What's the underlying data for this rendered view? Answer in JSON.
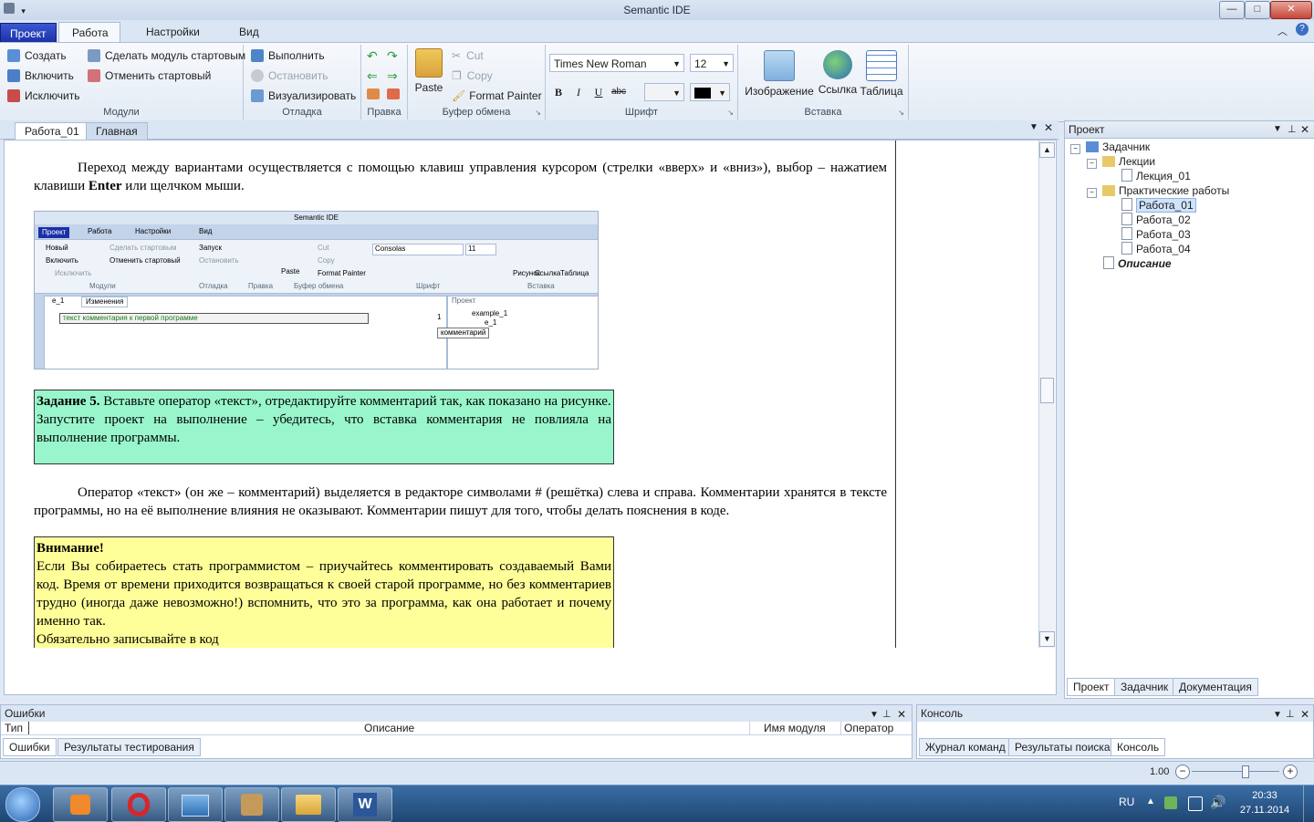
{
  "window": {
    "title": "Semantic IDE",
    "buttons": {
      "minimize": "—",
      "maximize": "□",
      "close": "✕"
    }
  },
  "ribbon_tabs": [
    "Проект",
    "Работа",
    "Настройки",
    "Вид"
  ],
  "ribbon": {
    "modules": {
      "label": "Модули",
      "create": "Создать",
      "include": "Включить",
      "exclude": "Исключить",
      "make_start": "Сделать модуль стартовым",
      "cancel_start": "Отменить стартовый"
    },
    "debug": {
      "label": "Отладка",
      "run": "Выполнить",
      "stop": "Остановить",
      "visualize": "Визуализировать"
    },
    "edit": {
      "label": "Правка"
    },
    "clipboard": {
      "label": "Буфер обмена",
      "paste": "Paste",
      "cut": "Cut",
      "copy": "Copy",
      "format_painter": "Format Painter"
    },
    "font": {
      "label": "Шрифт",
      "family": "Times New Roman",
      "size": "12",
      "bold": "B",
      "italic": "I",
      "underline": "U",
      "strike": "abc"
    },
    "insert": {
      "label": "Вставка",
      "image": "Изображение",
      "link": "Ссылка",
      "table": "Таблица"
    }
  },
  "doc_tabs": [
    "Работа_01",
    "Главная"
  ],
  "document": {
    "p1": "Переход между вариантами осуществляется с помощью клавиш управления курсором (стрелки «вверх» и «вниз»), выбор – нажатием клавиши",
    "p1_bold": "Enter",
    "p1_end": "или щелчком мыши.",
    "task_title": "Задание 5.",
    "task_text": "Вставьте оператор «текст», отредактируйте комментарий так, как показано на рисунке.",
    "task_text2": "Запустите проект на выполнение – убедитесь, что вставка комментария не повлияла на выполнение программы.",
    "p2": "Оператор «текст» (он же – комментарий) выделяется в редакторе символами # (решётка) слева и справа. Комментарии хранятся в тексте программы, но на её выполнение влияния не оказывают. Комментарии пишут для того, чтобы делать пояснения в коде.",
    "warn_title": "Внимание!",
    "warn_text": "Если Вы собираетесь стать программистом – приучайтесь комментировать создаваемый Вами код. Время от времени приходится возвращаться к своей старой программе, но без комментариев трудно (иногда даже невозможно!) вспомнить, что это за программа, как она работает и почему именно так.",
    "warn_text2": "Обязательно записывайте в код"
  },
  "embedded": {
    "title": "Semantic IDE",
    "tabs": [
      "Проект",
      "Работа",
      "Настройки",
      "Вид"
    ],
    "new": "Новый",
    "include": "Включить",
    "exclude": "Исключить",
    "make_start": "Сделать стартовым",
    "cancel_start": "Отменить стартовый",
    "run": "Запуск",
    "stop": "Остановить",
    "paste": "Paste",
    "cut": "Cut",
    "copy": "Copy",
    "format_painter": "Format Painter",
    "font": "Consolas",
    "size": "11",
    "image": "Рисунок",
    "link": "Ссылка",
    "table": "Таблица",
    "g_modules": "Модули",
    "g_debug": "Отладка",
    "g_edit": "Правка",
    "g_clip": "Буфер обмена",
    "g_font": "Шрифт",
    "g_insert": "Вставка",
    "doc_tab1": "e_1",
    "doc_tab2": "Изменения",
    "comment_line": "текст комментария к первой программе",
    "line_num": "1",
    "project_label": "Проект",
    "tree_root": "example_1",
    "tree_child": "e_1",
    "tooltip": "комментарий"
  },
  "project_panel": {
    "title": "Проект",
    "root": "Задачник",
    "lectures": "Лекции",
    "lecture_01": "Лекция_01",
    "practicals": "Практические работы",
    "works": [
      "Работа_01",
      "Работа_02",
      "Работа_03",
      "Работа_04"
    ],
    "description": "Описание",
    "tabs": [
      "Проект",
      "Задачник",
      "Документация"
    ]
  },
  "errors_panel": {
    "title": "Ошибки",
    "columns": [
      "Тип",
      "Описание",
      "Имя модуля",
      "Оператор"
    ],
    "tabs": [
      "Ошибки",
      "Результаты тестирования"
    ]
  },
  "console_panel": {
    "title": "Консоль",
    "tabs": [
      "Журнал команд",
      "Результаты поиска",
      "Консоль"
    ]
  },
  "status": {
    "zoom": "1.00",
    "zoom_level": 0.6
  },
  "taskbar": {
    "lang": "RU",
    "time": "20:33",
    "date": "27.11.2014"
  },
  "colors": {
    "task_box": "#99f6cc",
    "warn_box": "#ffff99",
    "accent": "#1c2fa8"
  }
}
